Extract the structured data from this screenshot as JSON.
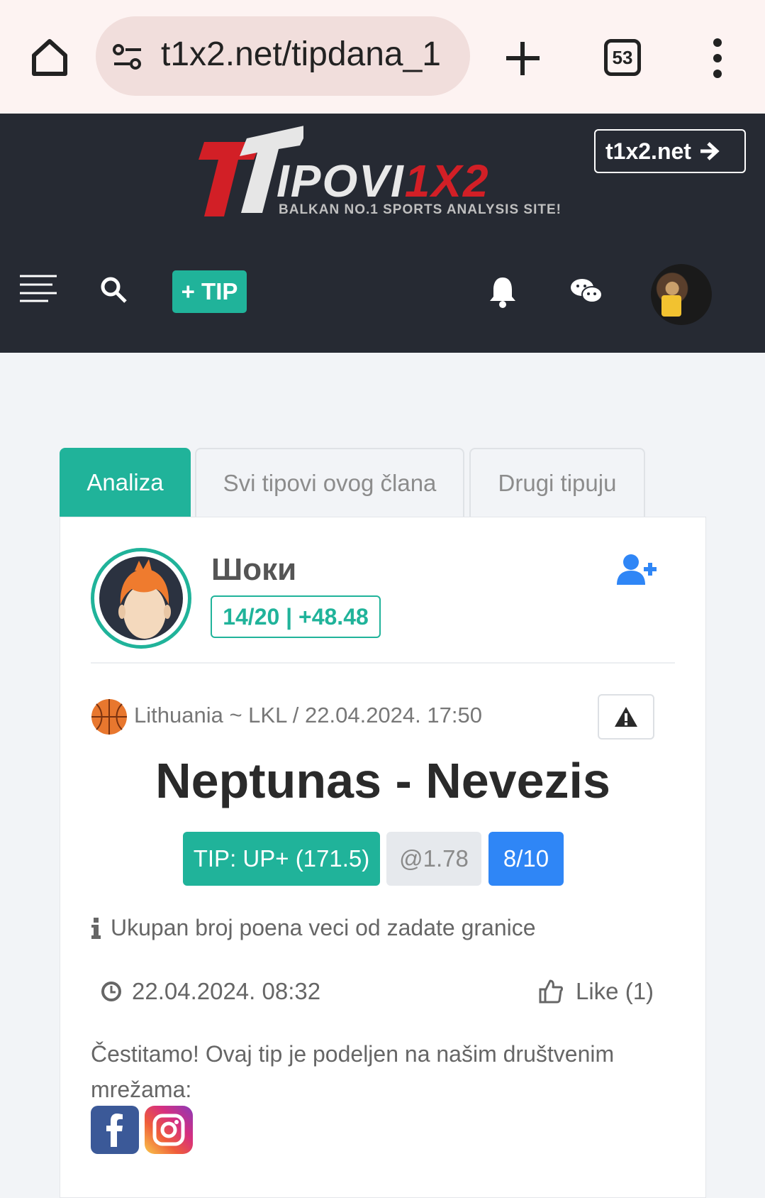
{
  "browser": {
    "url": "t1x2.net/tipdana_1",
    "tab_count": "53"
  },
  "header": {
    "logo_main": "IPOVI",
    "logo_accent": "1X2",
    "logo_tagline": "BALKAN NO.1 SPORTS ANALYSIS SITE!",
    "site_button": "t1x2.net",
    "tip_button": "+ TIP"
  },
  "tabs": [
    {
      "label": "Analiza",
      "active": true
    },
    {
      "label": "Svi tipovi ovog člana",
      "active": false
    },
    {
      "label": "Drugi tipuju",
      "active": false
    }
  ],
  "tipster": {
    "name": "Шоки",
    "stats": "14/20 | +48.48"
  },
  "tip": {
    "league": "Lithuania ~ LKL / 22.04.2024. 17:50",
    "match": "Neptunas - Nevezis",
    "tip_label": "TIP: UP+ (171.5)",
    "odds": "@1.78",
    "confidence": "8/10",
    "description": "Ukupan broj poena veci od zadate granice",
    "posted": "22.04.2024. 08:32",
    "likes": "Like (1)",
    "congrats": "Čestitamo! Ovaj tip je podeljen na našim društvenim mrežama:"
  },
  "colors": {
    "accent": "#20b39a",
    "header_bg": "#262a33",
    "confidence": "#2f86f6",
    "brand_red": "#d21f26"
  }
}
